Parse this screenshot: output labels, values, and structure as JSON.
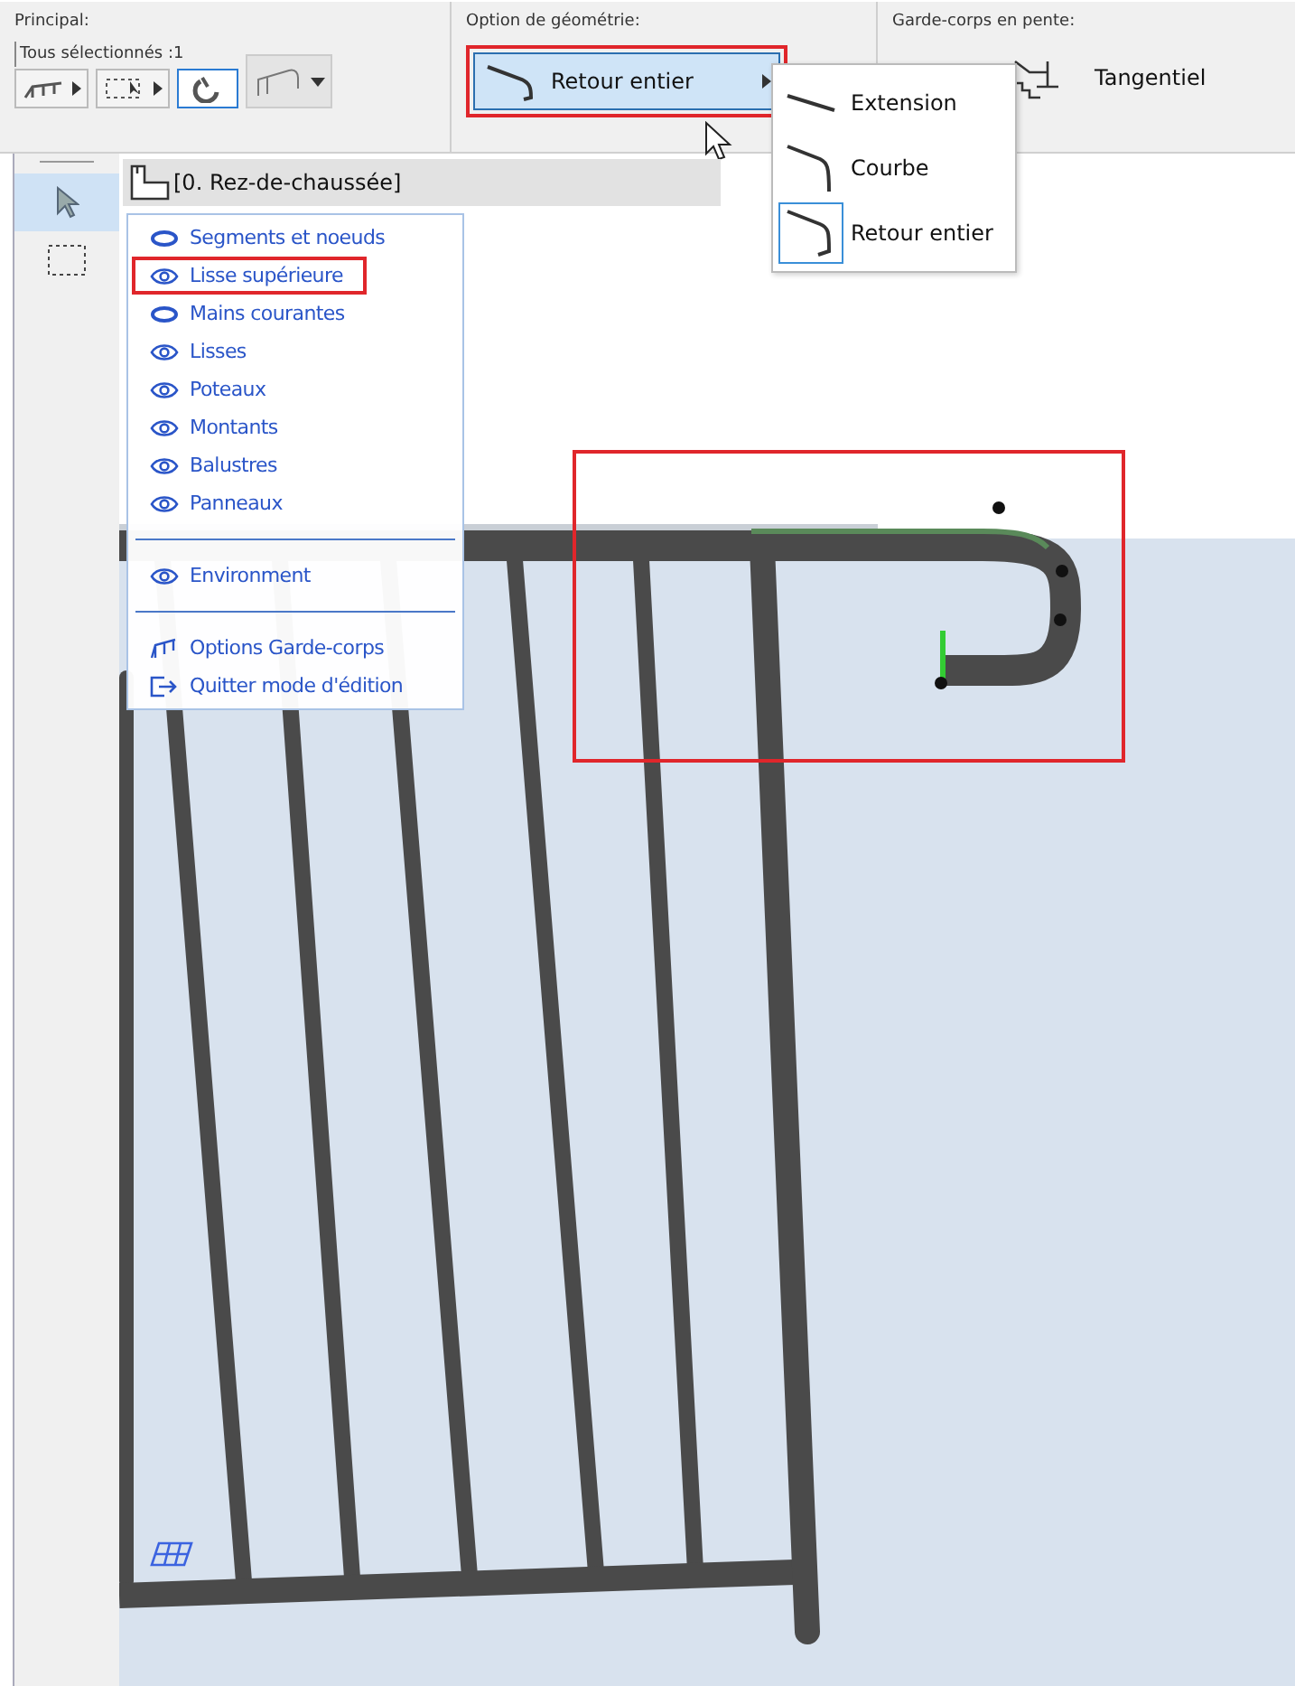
{
  "toolbar": {
    "principal": {
      "label": "Principal:",
      "selection": "Tous sélectionnés :1",
      "tools": [
        {
          "kind": "railing",
          "selected": false
        },
        {
          "kind": "marquee",
          "selected": false
        },
        {
          "kind": "magnet",
          "selected": true
        },
        {
          "kind": "profile",
          "selected": false
        }
      ]
    },
    "geometry": {
      "label": "Option de géométrie:",
      "button": "Retour entier",
      "highlighted": true,
      "submenu": [
        {
          "label": "Extension",
          "kind": "extension",
          "selected": false
        },
        {
          "label": "Courbe",
          "kind": "curve",
          "selected": false
        },
        {
          "label": "Retour entier",
          "kind": "return",
          "selected": true
        }
      ]
    },
    "slope": {
      "label": "Garde-corps en pente:",
      "option": "Tangentiel"
    }
  },
  "toolbox": [
    {
      "kind": "arrow",
      "selected": true
    },
    {
      "kind": "marquee",
      "selected": false
    }
  ],
  "view": {
    "story": "[0. Rez-de-chaussée]",
    "context_menu": [
      [
        {
          "label": "Segments et noeuds",
          "kind": "ring",
          "highlighted": false
        },
        {
          "label": "Lisse supérieure",
          "kind": "eye",
          "highlighted": true
        },
        {
          "label": "Mains courantes",
          "kind": "ring",
          "highlighted": false
        },
        {
          "label": "Lisses",
          "kind": "eye",
          "highlighted": false
        },
        {
          "label": "Poteaux",
          "kind": "eye",
          "highlighted": false
        },
        {
          "label": "Montants",
          "kind": "eye",
          "highlighted": false
        },
        {
          "label": "Balustres",
          "kind": "eye",
          "highlighted": false
        },
        {
          "label": "Panneaux",
          "kind": "eye",
          "highlighted": false
        }
      ],
      [
        {
          "label": "Environment",
          "kind": "eye",
          "highlighted": false
        }
      ],
      [
        {
          "label": "Options Garde-corps",
          "kind": "railing",
          "highlighted": false
        },
        {
          "label": "Quitter mode d'édition",
          "kind": "exit",
          "highlighted": false
        }
      ]
    ]
  }
}
